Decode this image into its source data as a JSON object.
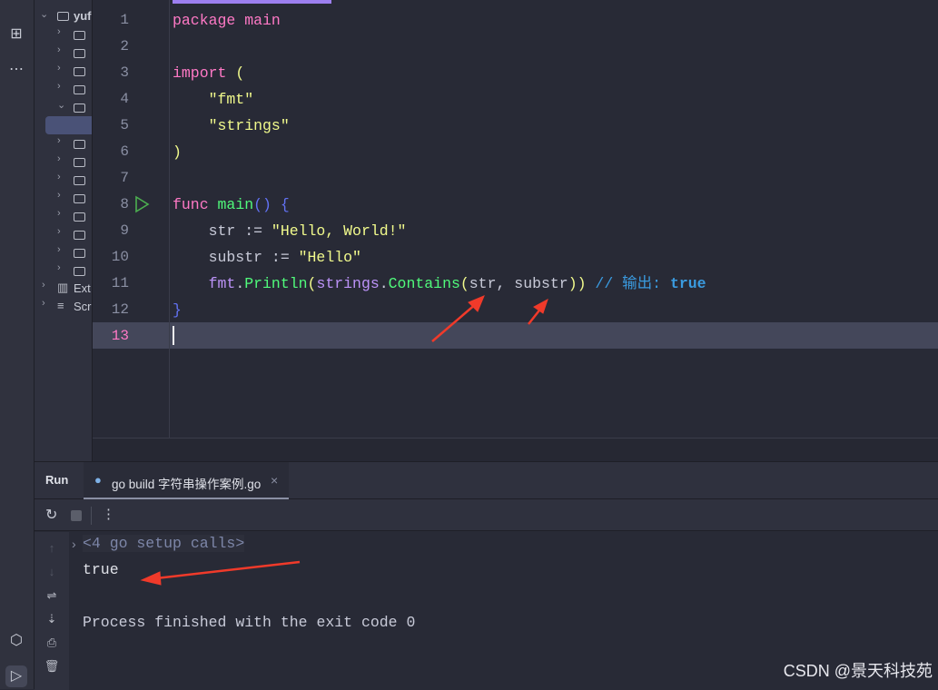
{
  "project_tree": {
    "root": "yuf",
    "items": [
      "Ext",
      "Scr"
    ]
  },
  "code_lines": [
    [
      {
        "t": "package ",
        "c": "kw"
      },
      {
        "t": "main",
        "c": "kw"
      }
    ],
    [],
    [
      {
        "t": "import ",
        "c": "kw"
      },
      {
        "t": "(",
        "c": "paren"
      }
    ],
    [
      {
        "t": "    \"fmt\"",
        "c": "str"
      }
    ],
    [
      {
        "t": "    \"strings\"",
        "c": "str"
      }
    ],
    [
      {
        "t": ")",
        "c": "paren"
      }
    ],
    [],
    [
      {
        "t": "func ",
        "c": "kw"
      },
      {
        "t": "main",
        "c": "fn"
      },
      {
        "t": "() {",
        "c": "brace"
      }
    ],
    [
      {
        "t": "    str := ",
        "c": "id"
      },
      {
        "t": "\"Hello, World!\"",
        "c": "str"
      }
    ],
    [
      {
        "t": "    substr := ",
        "c": "id"
      },
      {
        "t": "\"Hello\"",
        "c": "str"
      }
    ],
    [
      {
        "t": "    fmt",
        "c": "pkg"
      },
      {
        "t": ".",
        "c": "pl"
      },
      {
        "t": "Println",
        "c": "fn"
      },
      {
        "t": "(",
        "c": "paren"
      },
      {
        "t": "strings",
        "c": "pkg"
      },
      {
        "t": ".",
        "c": "pl"
      },
      {
        "t": "Contains",
        "c": "fn"
      },
      {
        "t": "(",
        "c": "paren"
      },
      {
        "t": "str, substr",
        "c": "id"
      },
      {
        "t": "))",
        "c": "paren"
      },
      {
        "t": " // 输出: ",
        "c": "cm"
      },
      {
        "t": "true",
        "c": "cmb"
      }
    ],
    [
      {
        "t": "}",
        "c": "brace"
      }
    ],
    []
  ],
  "run": {
    "label": "Run",
    "tab": "go build 字符串操作案例.go",
    "close": "×",
    "more": "⋮"
  },
  "output": {
    "setup": "<4 go setup calls>",
    "result": "true",
    "exit": "Process finished with the exit code 0"
  },
  "watermark": "CSDN @景天科技苑"
}
